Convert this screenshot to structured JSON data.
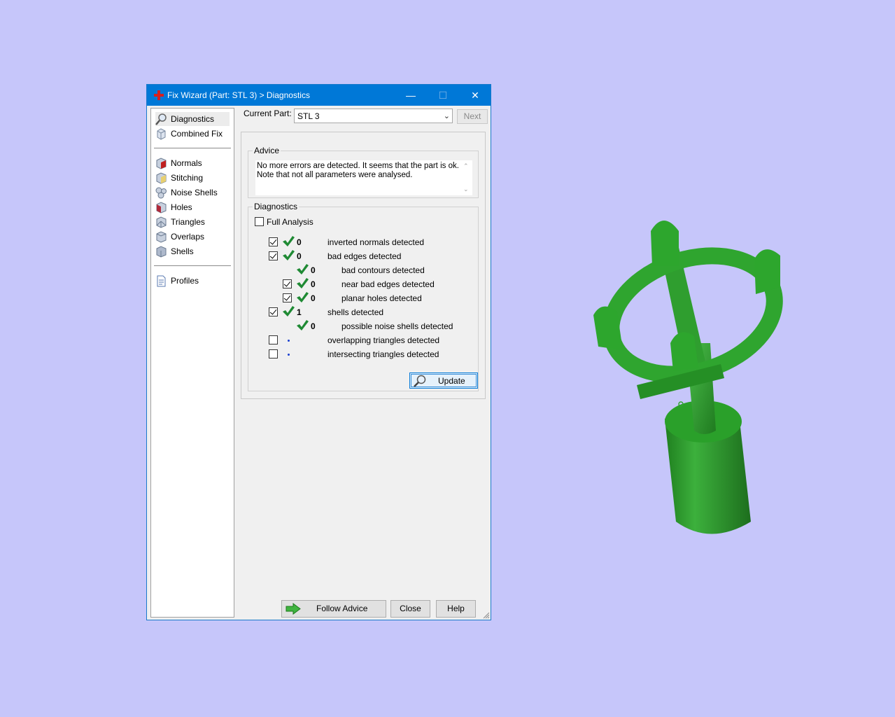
{
  "colors": {
    "background": "#c6c6fa",
    "titlebar": "#0078d7",
    "model_green": "#2e9a2e",
    "check_green": "#1f8a34",
    "dot_blue": "#1a3fd0"
  },
  "window": {
    "title": "Fix Wizard (Part: STL 3) > Diagnostics",
    "title_icon": "red-cross-icon",
    "minimize_glyph": "—",
    "maximize_glyph": "☐",
    "close_glyph": "✕"
  },
  "nav": {
    "items": [
      {
        "label": "Diagnostics",
        "icon": "magnifier-icon",
        "selected": true
      },
      {
        "label": "Combined Fix",
        "icon": "cube-icon"
      },
      {
        "label": "Normals",
        "icon": "normals-cube-icon"
      },
      {
        "label": "Stitching",
        "icon": "stitching-cube-icon"
      },
      {
        "label": "Noise Shells",
        "icon": "noise-shells-icon"
      },
      {
        "label": "Holes",
        "icon": "holes-cube-icon"
      },
      {
        "label": "Triangles",
        "icon": "triangles-cube-icon"
      },
      {
        "label": "Overlaps",
        "icon": "overlaps-cube-icon"
      },
      {
        "label": "Shells",
        "icon": "shells-cube-icon"
      },
      {
        "label": "Profiles",
        "icon": "document-icon"
      }
    ]
  },
  "current_part": {
    "label": "Current Part:",
    "value": "STL 3",
    "next_label": "Next"
  },
  "advice": {
    "title": "Advice",
    "text": "No more errors are detected. It seems that the part is ok. Note that not all parameters were analysed."
  },
  "diagnostics": {
    "title": "Diagnostics",
    "full_analysis_label": "Full Analysis",
    "full_analysis_checked": false,
    "rows": [
      {
        "checkbox": true,
        "checked": true,
        "status": "ok",
        "count": "0",
        "label": "inverted normals detected",
        "indent": 0
      },
      {
        "checkbox": true,
        "checked": true,
        "status": "ok",
        "count": "0",
        "label": "bad edges detected",
        "indent": 0
      },
      {
        "checkbox": false,
        "checked": false,
        "status": "ok",
        "count": "0",
        "label": "bad contours detected",
        "indent": 1
      },
      {
        "checkbox": true,
        "checked": true,
        "status": "ok",
        "count": "0",
        "label": "near bad edges detected",
        "indent": 1
      },
      {
        "checkbox": true,
        "checked": true,
        "status": "ok",
        "count": "0",
        "label": "planar holes detected",
        "indent": 1
      },
      {
        "checkbox": true,
        "checked": true,
        "status": "ok",
        "count": "1",
        "label": "shells detected",
        "indent": 0
      },
      {
        "checkbox": false,
        "checked": false,
        "status": "ok",
        "count": "0",
        "label": "possible noise shells detected",
        "indent": 1
      },
      {
        "checkbox": true,
        "checked": false,
        "status": "pending",
        "count": "",
        "label": "overlapping triangles detected",
        "indent": 0
      },
      {
        "checkbox": true,
        "checked": false,
        "status": "pending",
        "count": "",
        "label": "intersecting triangles detected",
        "indent": 0
      }
    ],
    "update_label": "Update"
  },
  "footer": {
    "follow_advice_label": "Follow Advice",
    "close_label": "Close",
    "help_label": "Help"
  }
}
